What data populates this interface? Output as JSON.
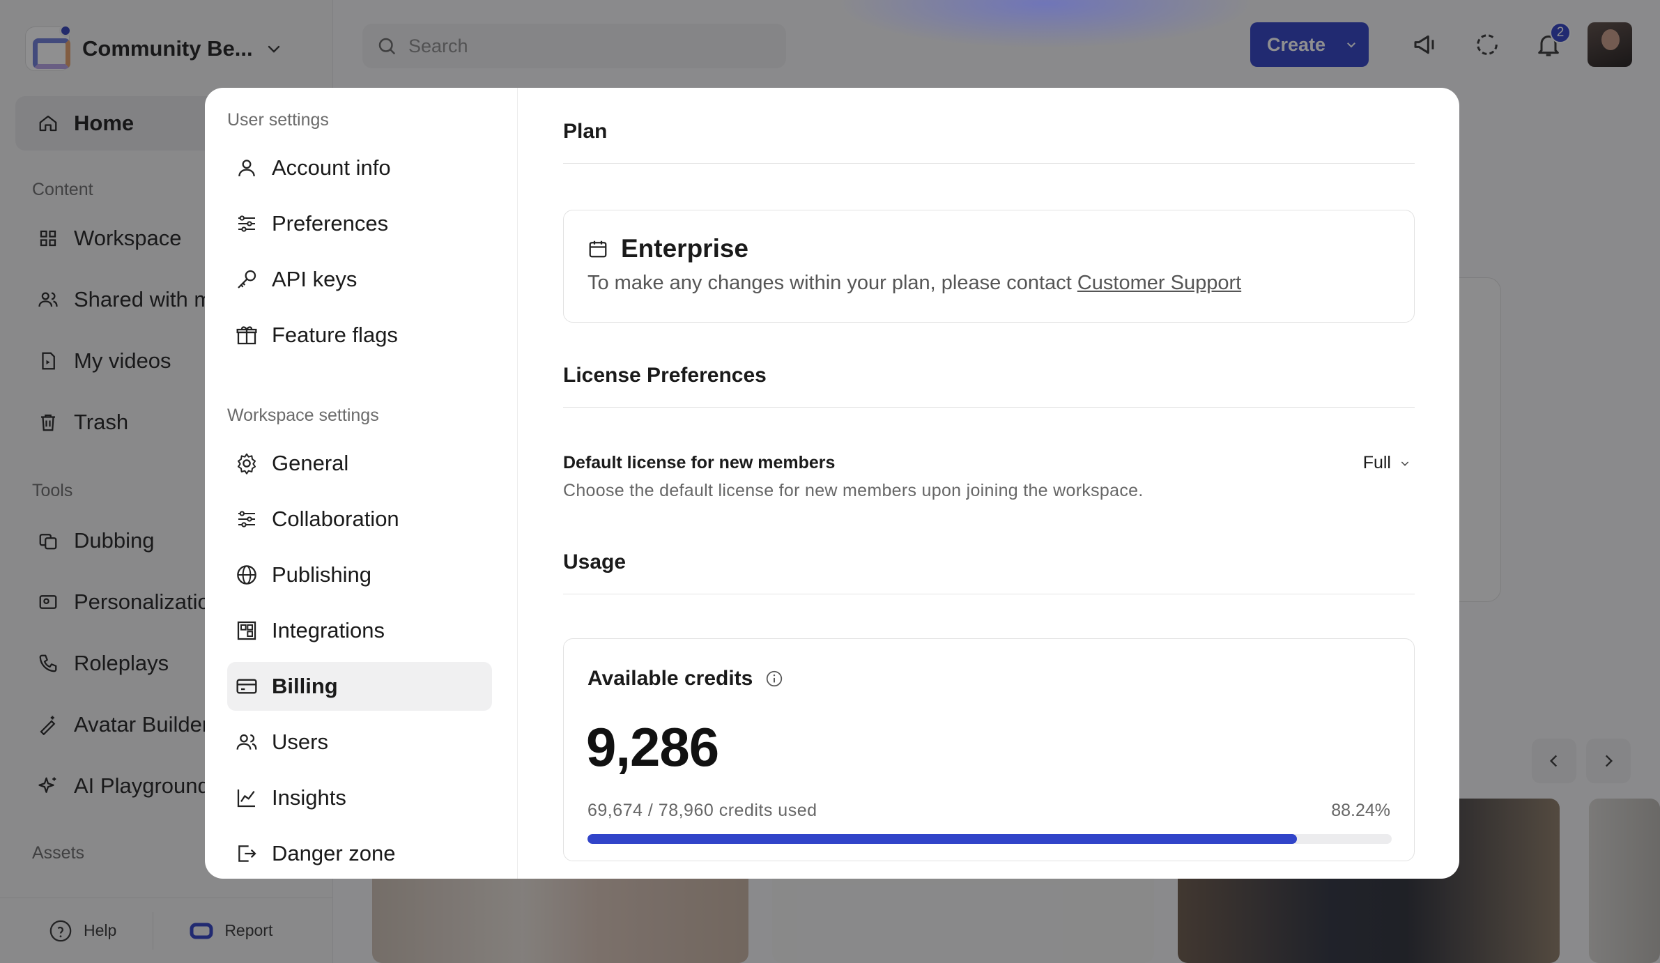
{
  "workspace": {
    "name": "Community Be..."
  },
  "sidebar": {
    "home": "Home",
    "sections": {
      "content": "Content",
      "tools": "Tools",
      "assets": "Assets"
    },
    "content_items": [
      "Workspace",
      "Shared with m",
      "My videos",
      "Trash"
    ],
    "tool_items": [
      "Dubbing",
      "Personalizatio",
      "Roleplays",
      "Avatar Builder",
      "AI Playground"
    ],
    "footer": {
      "help": "Help",
      "report": "Report"
    }
  },
  "topbar": {
    "search_placeholder": "Search",
    "create_label": "Create",
    "notification_count": "2"
  },
  "settings_nav": {
    "user_section": "User settings",
    "user_items": [
      "Account info",
      "Preferences",
      "API keys",
      "Feature flags"
    ],
    "workspace_section": "Workspace settings",
    "workspace_items": [
      "General",
      "Collaboration",
      "Publishing",
      "Integrations",
      "Billing",
      "Users",
      "Insights",
      "Danger zone"
    ],
    "active": "Billing"
  },
  "billing": {
    "plan_title": "Plan",
    "plan_name": "Enterprise",
    "plan_note": "To make any changes within your plan, please contact ",
    "plan_link": "Customer Support",
    "license_title": "License Preferences",
    "license_label": "Default license for new members",
    "license_desc": "Choose the default license for new members upon joining the workspace.",
    "license_value": "Full",
    "usage_title": "Usage",
    "credits_title": "Available credits",
    "credits_available": "9,286",
    "credits_used_text": "69,674 / 78,960 credits used",
    "credits_percent_text": "88.24%",
    "credits_fraction": 0.8824
  },
  "colors": {
    "accent": "#2c3fc4",
    "progress": "#3144c9"
  }
}
